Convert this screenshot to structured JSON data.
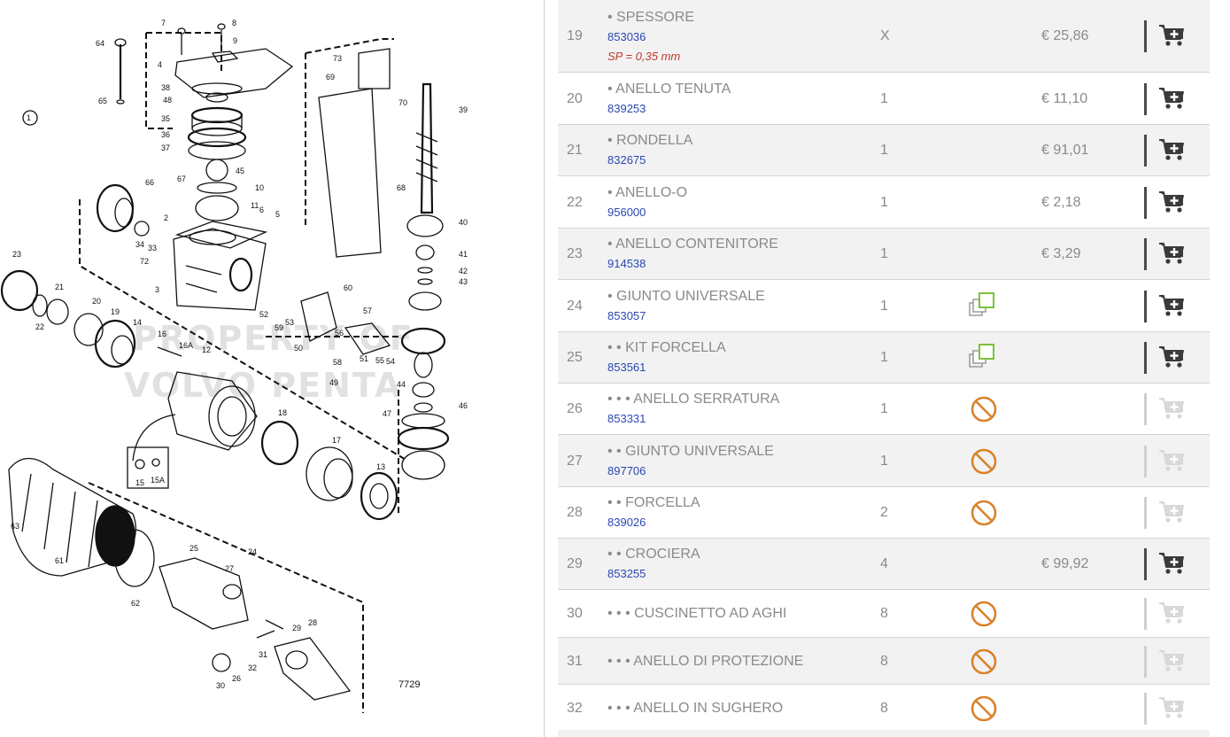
{
  "diagram": {
    "callouts": [
      "7",
      "8",
      "9",
      "64",
      "4",
      "65",
      "38",
      "48",
      "35",
      "36",
      "37",
      "45",
      "10",
      "11",
      "67",
      "66",
      "2",
      "6",
      "5",
      "34",
      "33",
      "72",
      "3",
      "23",
      "21",
      "22",
      "20",
      "19",
      "14",
      "16",
      "16A",
      "12",
      "18",
      "17",
      "13",
      "15",
      "15A",
      "63",
      "61",
      "62",
      "25",
      "27",
      "24",
      "29",
      "28",
      "31",
      "32",
      "26",
      "30",
      "73",
      "69",
      "70",
      "39",
      "68",
      "40",
      "41",
      "42",
      "43",
      "60",
      "56",
      "57",
      "58",
      "51",
      "55",
      "54",
      "50",
      "53",
      "59",
      "52",
      "49",
      "44",
      "46",
      "47",
      "1",
      "7729"
    ],
    "watermark_lines": [
      "PROPERTY OF",
      "VOLVO PENTA"
    ]
  },
  "colors": {
    "row_shaded": "#f2f2f2",
    "code_blue": "#2b47b0",
    "note_red": "#c0392b",
    "not_available_orange": "#d9822b",
    "copy_green": "#7cc23a",
    "cart_active": "#3a3a3a",
    "cart_disabled": "#d8d8d8"
  },
  "parts": [
    {
      "pos": "19",
      "name": "• SPESSORE",
      "code": "853036",
      "note": "SP = 0,35 mm",
      "qty": "X",
      "price": "€ 25,86",
      "status": "none",
      "cart": "active"
    },
    {
      "pos": "20",
      "name": "• ANELLO TENUTA",
      "code": "839253",
      "note": "",
      "qty": "1",
      "price": "€ 11,10",
      "status": "none",
      "cart": "active"
    },
    {
      "pos": "21",
      "name": "• RONDELLA",
      "code": "832675",
      "note": "",
      "qty": "1",
      "price": "€ 91,01",
      "status": "none",
      "cart": "active"
    },
    {
      "pos": "22",
      "name": "• ANELLO-O",
      "code": "956000",
      "note": "",
      "qty": "1",
      "price": "€ 2,18",
      "status": "none",
      "cart": "active"
    },
    {
      "pos": "23",
      "name": "• ANELLO CONTENITORE",
      "code": "914538",
      "note": "",
      "qty": "1",
      "price": "€ 3,29",
      "status": "none",
      "cart": "active"
    },
    {
      "pos": "24",
      "name": "• GIUNTO UNIVERSALE",
      "code": "853057",
      "note": "",
      "qty": "1",
      "price": "",
      "status": "copy-icon",
      "cart": "active"
    },
    {
      "pos": "25",
      "name": "• • KIT FORCELLA",
      "code": "853561",
      "note": "",
      "qty": "1",
      "price": "",
      "status": "copy-icon",
      "cart": "active"
    },
    {
      "pos": "26",
      "name": "• • • ANELLO SERRATURA",
      "code": "853331",
      "note": "",
      "qty": "1",
      "price": "",
      "status": "not-available-icon",
      "cart": "disabled"
    },
    {
      "pos": "27",
      "name": "• • GIUNTO UNIVERSALE",
      "code": "897706",
      "note": "",
      "qty": "1",
      "price": "",
      "status": "not-available-icon",
      "cart": "disabled"
    },
    {
      "pos": "28",
      "name": "• • FORCELLA",
      "code": "839026",
      "note": "",
      "qty": "2",
      "price": "",
      "status": "not-available-icon",
      "cart": "disabled"
    },
    {
      "pos": "29",
      "name": "• • CROCIERA",
      "code": "853255",
      "note": "",
      "qty": "4",
      "price": "€ 99,92",
      "status": "none",
      "cart": "active"
    },
    {
      "pos": "30",
      "name": "• • • CUSCINETTO AD AGHI",
      "code": "",
      "note": "",
      "qty": "8",
      "price": "",
      "status": "not-available-icon",
      "cart": "disabled"
    },
    {
      "pos": "31",
      "name": "• • • ANELLO DI PROTEZIONE",
      "code": "",
      "note": "",
      "qty": "8",
      "price": "",
      "status": "not-available-icon",
      "cart": "disabled"
    },
    {
      "pos": "32",
      "name": "• • • ANELLO IN SUGHERO",
      "code": "",
      "note": "",
      "qty": "8",
      "price": "",
      "status": "not-available-icon",
      "cart": "disabled"
    }
  ]
}
